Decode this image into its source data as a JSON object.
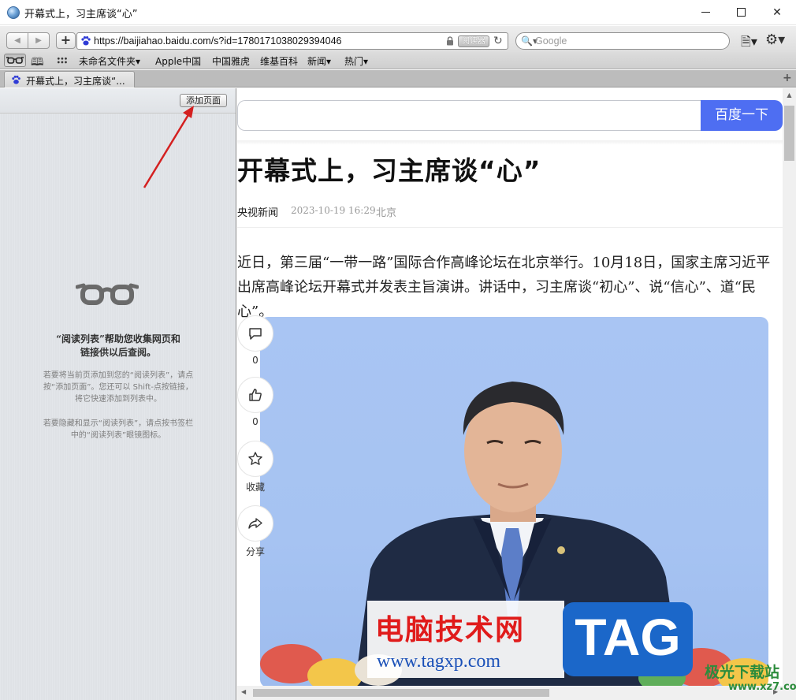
{
  "window": {
    "title": "开幕式上，习主席谈“心”",
    "controls": {
      "minimize": "minimize",
      "maximize": "maximize",
      "close": "✕"
    }
  },
  "toolbar": {
    "back": "◀",
    "forward": "▶",
    "add": "+",
    "url": "https://baijiahao.baidu.com/s?id=1780171038029394046",
    "reader_badge": "阅读器",
    "reload": "↻",
    "search_placeholder": "Google",
    "search_icon": "🔍▾",
    "page_menu": "🗎▾",
    "settings_menu": "⚙▾"
  },
  "bookmarks": {
    "items": [
      {
        "label": "未命名文件夹▾"
      },
      {
        "label": "Apple中国"
      },
      {
        "label": "中国雅虎"
      },
      {
        "label": "维基百科"
      },
      {
        "label": "新闻▾"
      },
      {
        "label": "热门▾"
      }
    ]
  },
  "tab": {
    "label": "开幕式上，习主席谈“...",
    "new_tab": "+"
  },
  "reading_list": {
    "add_page": "添加页面",
    "heading_line1": "“阅读列表”帮助您收集网页和",
    "heading_line2": "链接供以后查阅。",
    "help1": "若要将当前页添加到您的“阅读列表”，请点按“添加页面”。您还可以 Shift-点按链接，将它快速添加到列表中。",
    "help2": "若要隐藏和显示“阅读列表”，请点按书签栏中的“阅读列表”眼镜图标。"
  },
  "page": {
    "search_button": "百度一下",
    "title": "开幕式上，习主席谈“心”",
    "source": "央视新闻",
    "time": "2023-10-19 16:29",
    "location": "北京",
    "paragraph": "近日，第三届“一带一路”国际合作高峰论坛在北京举行。10月18日，国家主席习近平出席高峰论坛开幕式并发表主旨演讲。讲话中，习主席谈“初心”、说“信心”、道“民心”。",
    "actions": {
      "comment_count": "0",
      "like_count": "0",
      "favorite": "收藏",
      "share": "分享"
    }
  },
  "watermark": {
    "title": "电脑技术网",
    "url": "www.tagxp.com",
    "tag": "TAG",
    "site": "极光下载站",
    "site_url": "www.xz7.com"
  },
  "colors": {
    "baidu_blue": "#4e6ef2",
    "arrow_red": "#d42020"
  }
}
